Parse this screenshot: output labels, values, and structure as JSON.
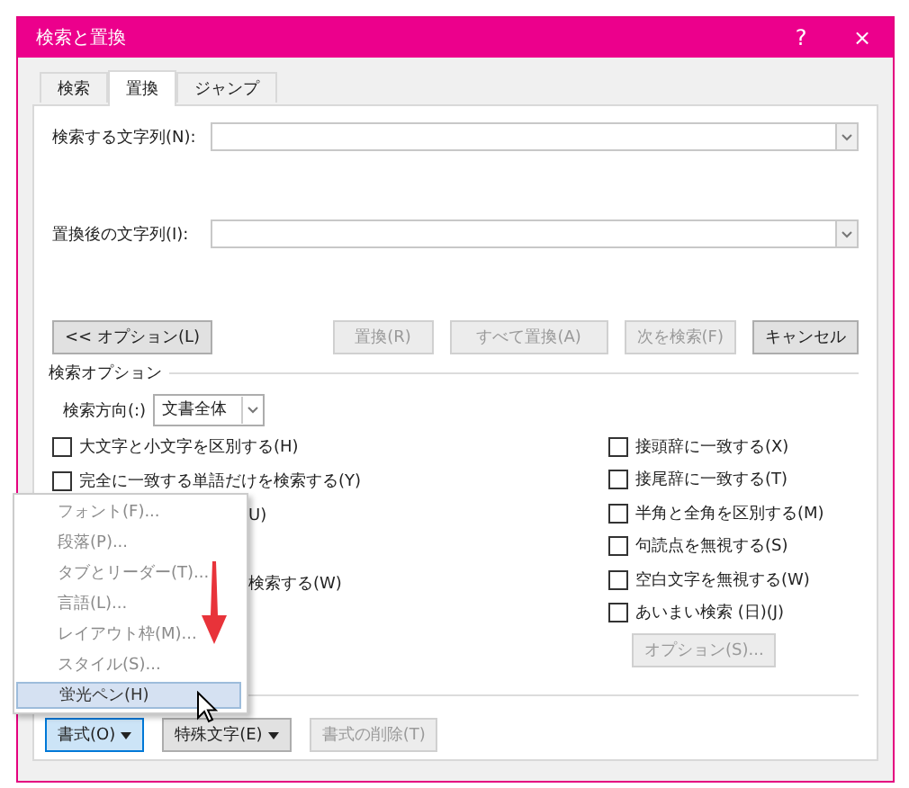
{
  "window": {
    "title": "検索と置換",
    "help": "?",
    "close": "×"
  },
  "tabs": [
    {
      "label": "検索",
      "selected": false
    },
    {
      "label": "置換",
      "selected": true
    },
    {
      "label": "ジャンプ",
      "selected": false
    }
  ],
  "find_field": {
    "label": "検索する文字列(N):"
  },
  "replace_field": {
    "label": "置換後の文字列(I):"
  },
  "action_buttons": [
    {
      "label": "<< オプション(L)",
      "disabled": false
    },
    {
      "label": "置換(R)",
      "disabled": true
    },
    {
      "label": "すべて置換(A)",
      "disabled": true
    },
    {
      "label": "次を検索(F)",
      "disabled": true
    },
    {
      "label": "キャンセル",
      "disabled": false
    }
  ],
  "search_options": {
    "title": "検索オプション",
    "direction_label": "検索方向(:)",
    "direction_value": "文書全体",
    "left": [
      {
        "kind": "checkbox",
        "label": "大文字と小文字を区別する(H)",
        "checked": false
      },
      {
        "kind": "checkbox",
        "label": "完全に一致する単語だけを検索する(Y)",
        "checked": false
      },
      {
        "kind": "partial",
        "label": "U)"
      },
      {
        "kind": "partial",
        "label": "検索する(W)"
      }
    ],
    "right": [
      {
        "label": "接頭辞に一致する(X)",
        "checked": false
      },
      {
        "label": "接尾辞に一致する(T)",
        "checked": false
      },
      {
        "label": "半角と全角を区別する(M)",
        "checked": false
      },
      {
        "label": "句読点を無視する(S)",
        "checked": false
      },
      {
        "label": "空白文字を無視する(W)",
        "checked": false
      },
      {
        "label": "あいまい検索 (日)(J)",
        "checked": false
      }
    ],
    "options_button": {
      "label": "オプション(S)...",
      "disabled": true
    }
  },
  "bottom_buttons": [
    {
      "label": "書式(O)",
      "dropdown": true,
      "disabled": false,
      "active": true
    },
    {
      "label": "特殊文字(E)",
      "dropdown": true,
      "disabled": false,
      "active": false
    },
    {
      "label": "書式の削除(T)",
      "dropdown": false,
      "disabled": true,
      "active": false
    }
  ],
  "format_menu": [
    {
      "label": "フォント(F)...",
      "selected": false
    },
    {
      "label": "段落(P)...",
      "selected": false
    },
    {
      "label": "タブとリーダー(T)...",
      "selected": false
    },
    {
      "label": "言語(L)...",
      "selected": false
    },
    {
      "label": "レイアウト枠(M)...",
      "selected": false
    },
    {
      "label": "スタイル(S)...",
      "selected": false
    },
    {
      "label": "蛍光ペン(H)",
      "selected": true
    }
  ]
}
